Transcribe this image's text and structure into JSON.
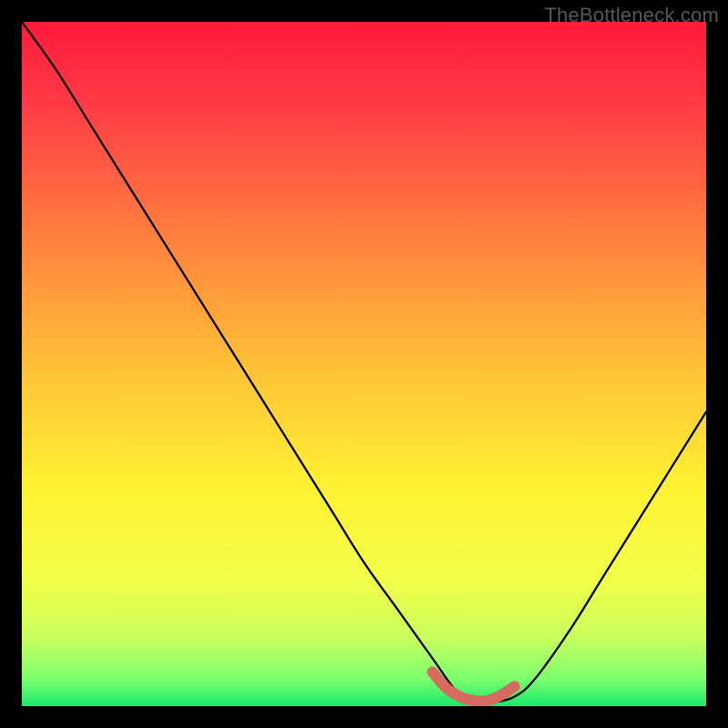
{
  "watermark": "TheBottleneck.com",
  "chart_data": {
    "type": "line",
    "title": "",
    "xlabel": "",
    "ylabel": "",
    "xlim": [
      0,
      100
    ],
    "ylim": [
      0,
      100
    ],
    "x": [
      0,
      5,
      10,
      15,
      20,
      25,
      30,
      35,
      40,
      45,
      50,
      55,
      60,
      63,
      65,
      67,
      69,
      72,
      75,
      80,
      85,
      90,
      95,
      100
    ],
    "values": [
      100,
      93,
      85,
      77,
      69,
      61,
      53,
      45,
      37,
      29,
      21,
      14,
      7,
      2.8,
      1.2,
      0.6,
      0.6,
      1.4,
      4,
      11,
      19,
      27,
      35,
      43
    ],
    "highlight": {
      "x": [
        60,
        62,
        64,
        66,
        68,
        70,
        72
      ],
      "values": [
        5.0,
        2.7,
        1.4,
        0.8,
        0.8,
        1.6,
        2.9
      ]
    },
    "gradient_stops": [
      {
        "offset": 0.0,
        "color": "#ff1a3a"
      },
      {
        "offset": 0.12,
        "color": "#ff3b46"
      },
      {
        "offset": 0.3,
        "color": "#ff7b3e"
      },
      {
        "offset": 0.5,
        "color": "#ffc038"
      },
      {
        "offset": 0.68,
        "color": "#fff233"
      },
      {
        "offset": 0.82,
        "color": "#f1ff49"
      },
      {
        "offset": 0.9,
        "color": "#c9ff5d"
      },
      {
        "offset": 0.96,
        "color": "#7dff6e"
      },
      {
        "offset": 1.0,
        "color": "#17e86c"
      }
    ],
    "line_color": "#000000",
    "highlight_color": "#d66a5e",
    "highlight_width": 12
  }
}
